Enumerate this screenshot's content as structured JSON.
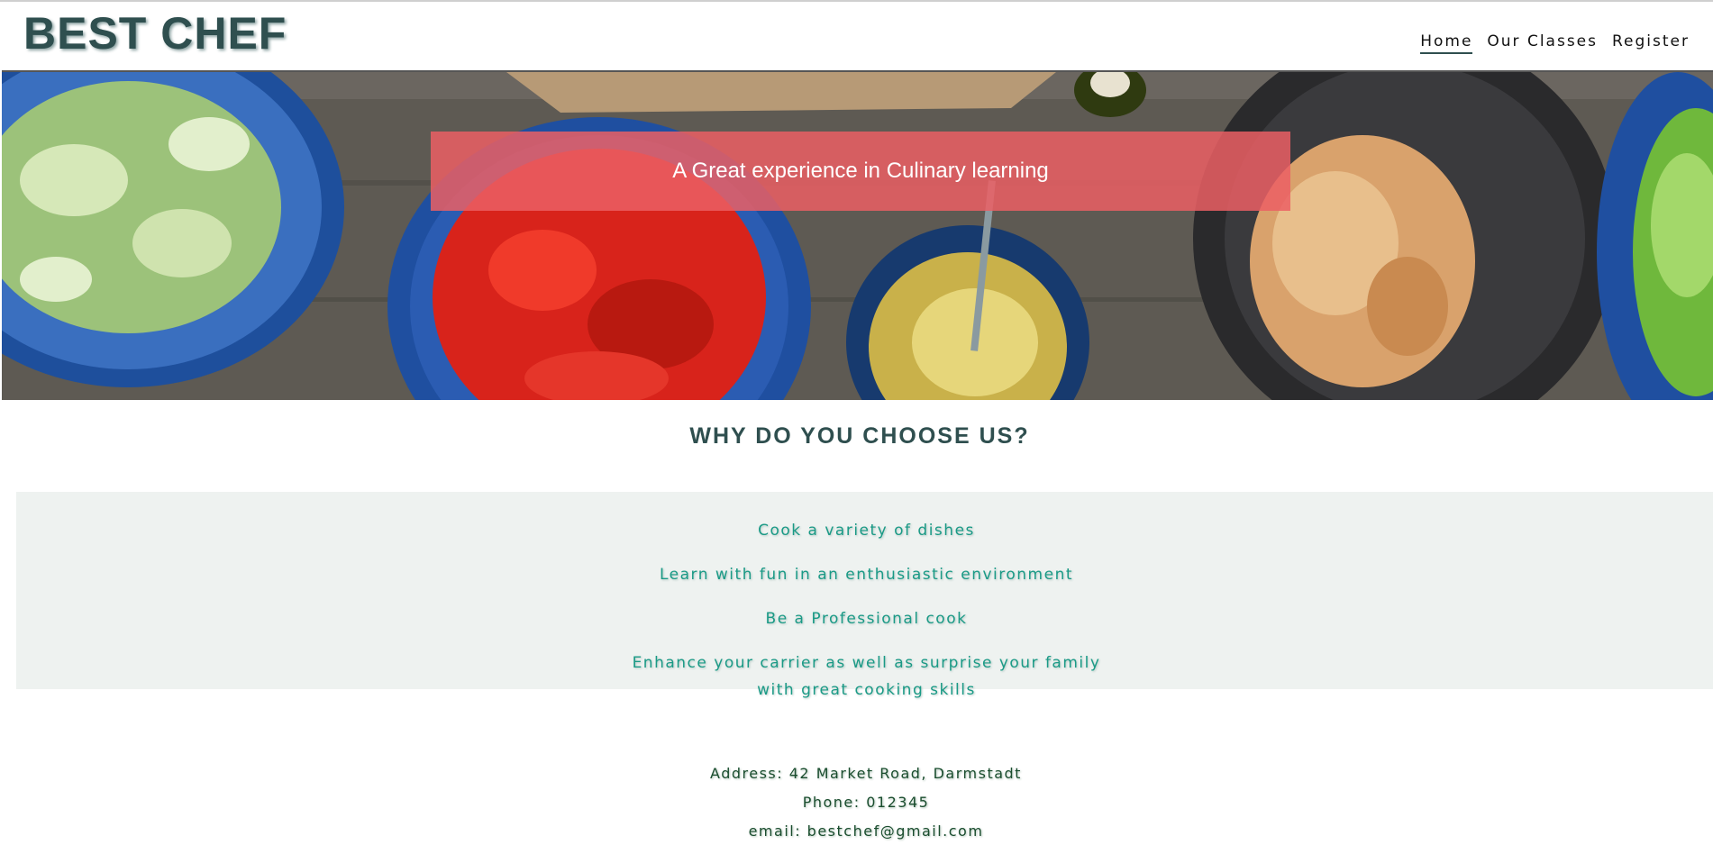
{
  "header": {
    "logo": "BEST CHEF",
    "nav": [
      {
        "label": "Home",
        "active": true
      },
      {
        "label": "Our Classes",
        "active": false
      },
      {
        "label": "Register",
        "active": false
      }
    ]
  },
  "hero": {
    "tagline": "A Great experience in Culinary learning"
  },
  "why": {
    "title": "WHY DO YOU CHOOSE US?",
    "items": [
      "Cook a variety of dishes",
      "Learn with fun in an enthusiastic environment",
      "Be a Professional cook",
      "Enhance your carrier as well as surprise your family with great cooking skills"
    ]
  },
  "contact": {
    "address": "Address: 42 Market Road, Darmstadt",
    "phone": "Phone: 012345",
    "email": "email: bestchef@gmail.com"
  },
  "colors": {
    "logo": "#2f4f4f",
    "banner": "#eb5f64",
    "feature_text": "#1a9a86",
    "feature_bg": "#eef2f0"
  }
}
